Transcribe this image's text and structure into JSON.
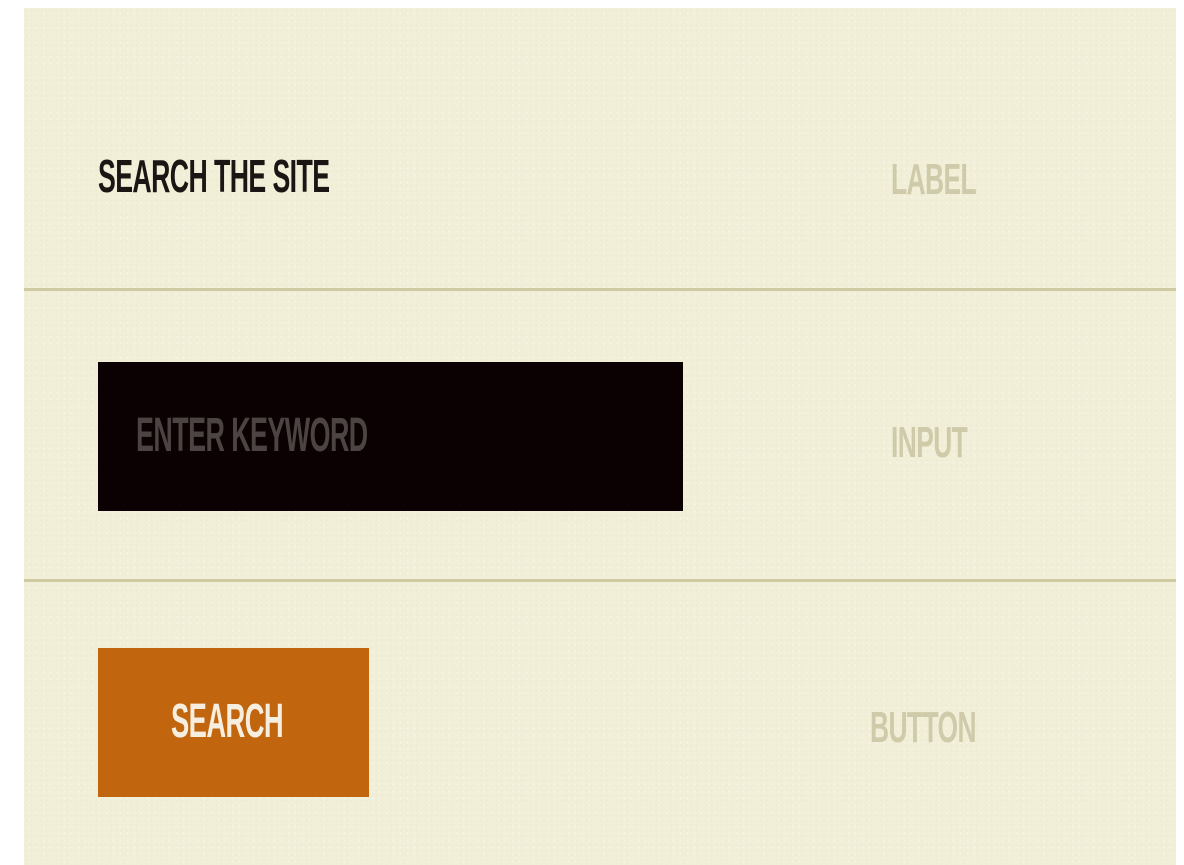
{
  "colors": {
    "background": "#f2efd8",
    "divider": "#cfcaa2",
    "heading_text": "#1b1614",
    "annotation_text": "#cfcaa9",
    "input_background": "#0c0102",
    "input_placeholder": "#4b4442",
    "button_background": "#c1650e",
    "button_text": "#f6eedf"
  },
  "label_row": {
    "heading": "SEARCH THE SITE",
    "annotation": "LABEL"
  },
  "input_row": {
    "placeholder": "ENTER KEYWORD",
    "value": "",
    "annotation": "INPUT"
  },
  "button_row": {
    "label": "SEARCH",
    "annotation": "BUTTON"
  }
}
